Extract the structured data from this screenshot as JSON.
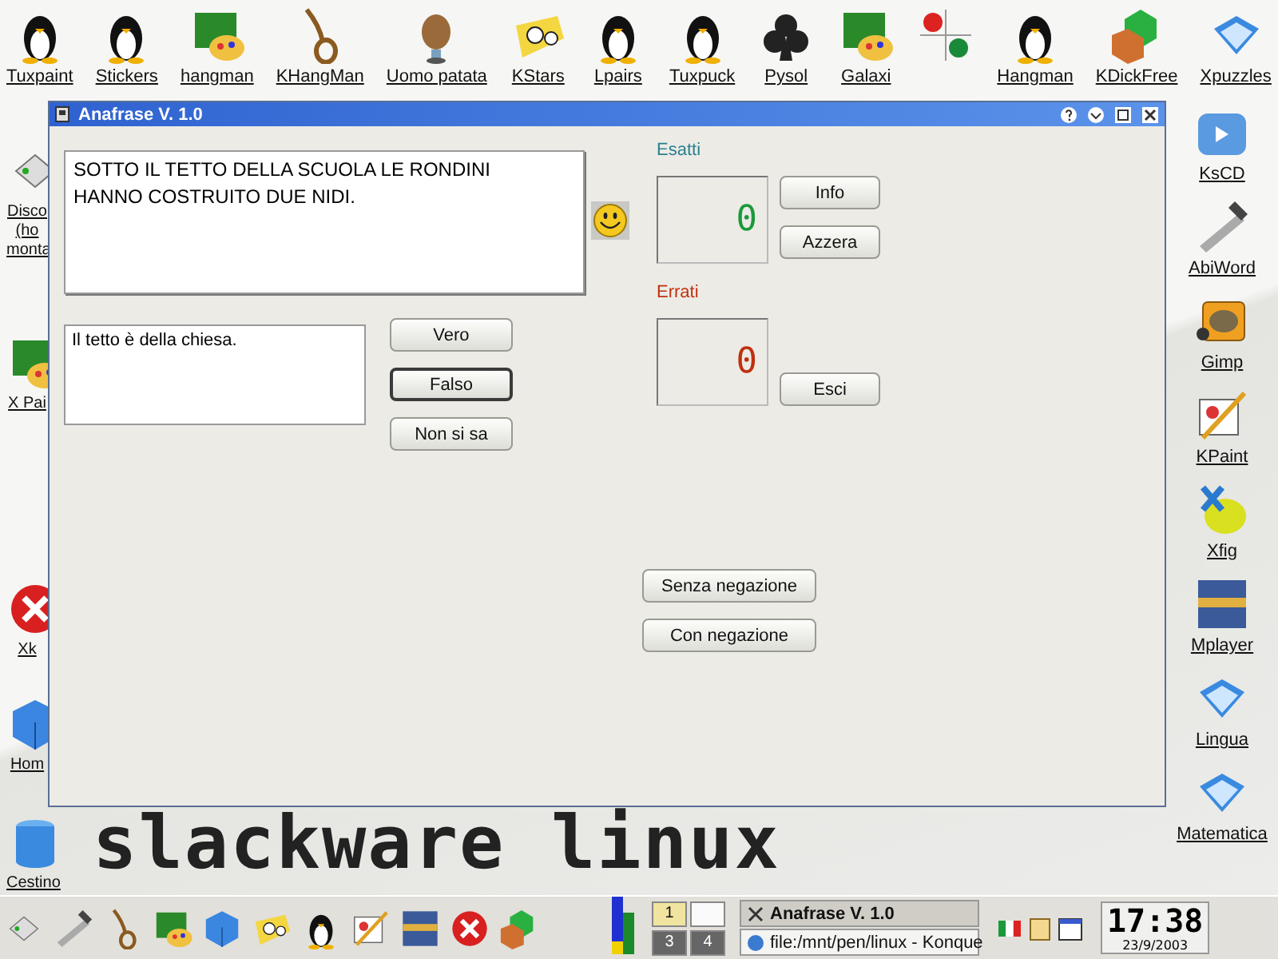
{
  "desktop": {
    "wallpaper_text": "slackware linux",
    "top_icons": [
      {
        "label": "Tuxpaint"
      },
      {
        "label": "Stickers"
      },
      {
        "label": "hangman"
      },
      {
        "label": "KHangMan"
      },
      {
        "label": "Uomo patata"
      },
      {
        "label": "KStars"
      },
      {
        "label": "Lpairs"
      },
      {
        "label": "Tuxpuck"
      },
      {
        "label": "Pysol"
      },
      {
        "label": "Galaxi"
      },
      {
        "label": "Hangman"
      },
      {
        "label": "KDickFree"
      },
      {
        "label": "Xpuzzles"
      }
    ],
    "left_icons": [
      {
        "label": "Disco (ho monta"
      },
      {
        "label": "X Pai"
      },
      {
        "label": "Xk"
      },
      {
        "label": "Hom"
      },
      {
        "label": "Cestino"
      }
    ],
    "right_icons": [
      {
        "label": "KsCD"
      },
      {
        "label": "AbiWord"
      },
      {
        "label": "Gimp"
      },
      {
        "label": "KPaint"
      },
      {
        "label": "Xfig"
      },
      {
        "label": "Mplayer"
      },
      {
        "label": "Lingua"
      },
      {
        "label": "Matematica"
      }
    ]
  },
  "window": {
    "title": "Anafrase V. 1.0",
    "sentence": "SOTTO IL TETTO DELLA SCUOLA LE RONDINI HANNO COSTRUITO DUE NIDI.",
    "statement": "Il tetto è della chiesa.",
    "answer_buttons": [
      {
        "label": "Vero",
        "selected": false
      },
      {
        "label": "Falso",
        "selected": true
      },
      {
        "label": "Non si sa",
        "selected": false
      }
    ],
    "counters": [
      {
        "label": "Esatti",
        "value": "0",
        "color": "#2a7f8f"
      },
      {
        "label": "Errati",
        "value": "0",
        "color": "#c0300f"
      }
    ],
    "side_buttons": [
      "Info",
      "Azzera",
      "Esci"
    ],
    "mode_buttons": [
      "Senza negazione",
      "Con negazione"
    ]
  },
  "taskbar": {
    "pager": [
      {
        "label": "1",
        "selected": true
      },
      {
        "selected": false
      },
      {
        "label": "3",
        "selected": false
      },
      {
        "label": "4",
        "selected": false
      }
    ],
    "tasks": [
      {
        "label": "Anafrase V. 1.0",
        "selected": true
      },
      {
        "label": "file:/mnt/pen/linux - Konque",
        "selected": false
      }
    ],
    "clock": "17:38",
    "date": "23/9/2003"
  }
}
